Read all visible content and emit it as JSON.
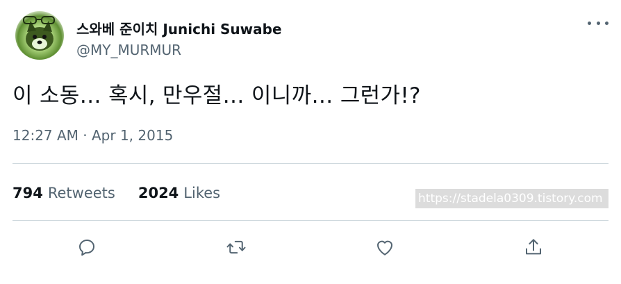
{
  "author": {
    "name": "스와베 준이치 Junichi Suwabe",
    "handle": "@MY_MURMUR"
  },
  "tweet": {
    "text": "이 소동… 혹시, 만우절… 이니까… 그런가!?",
    "timestamp": "12:27 AM · Apr 1, 2015"
  },
  "stats": {
    "retweets_count": "794",
    "retweets_label": "Retweets",
    "likes_count": "2024",
    "likes_label": "Likes"
  },
  "watermark": "https://stadela0309.tistory.com",
  "icons": {
    "more": "more-options-icon",
    "reply": "reply-icon",
    "retweet": "retweet-icon",
    "like": "heart-icon",
    "share": "share-icon"
  },
  "colors": {
    "text_primary": "#0f1419",
    "text_secondary": "#536471",
    "divider": "#cfd9de"
  }
}
